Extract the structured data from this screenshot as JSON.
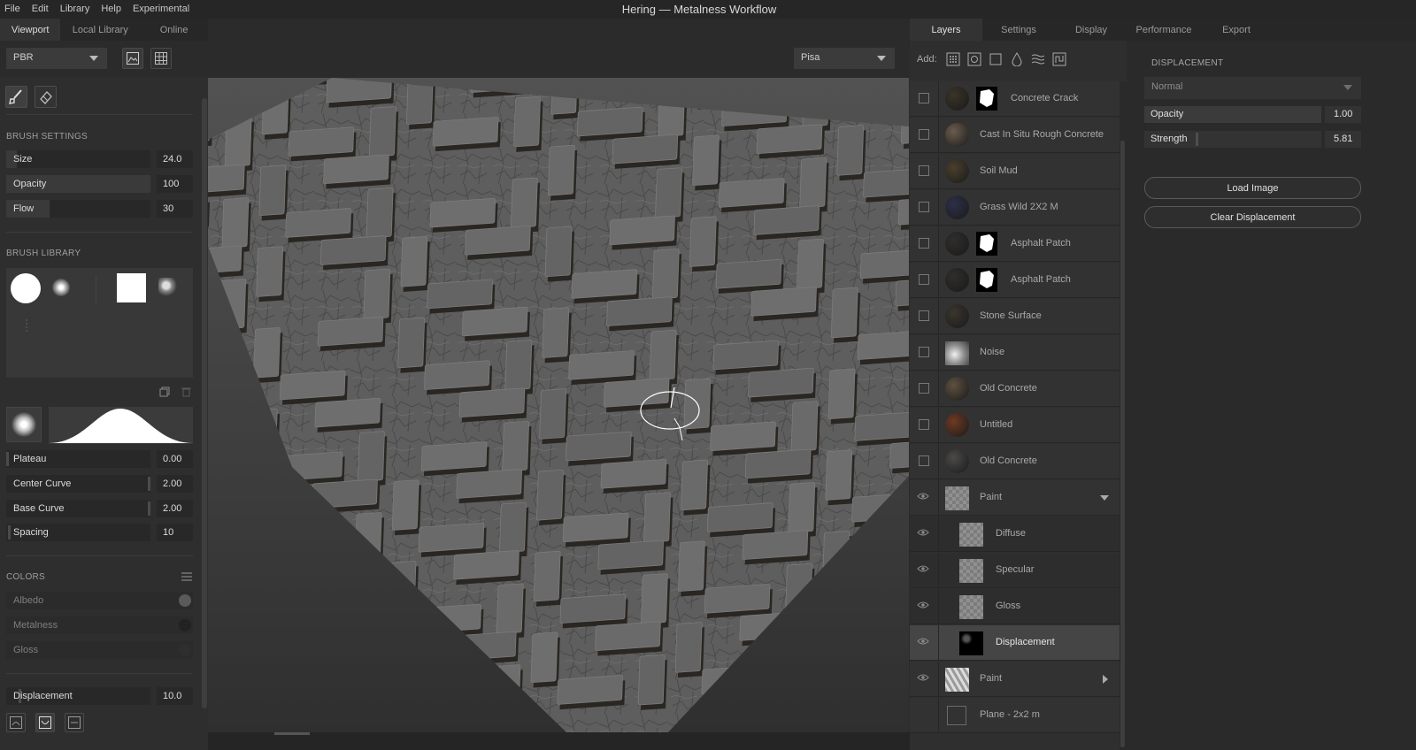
{
  "app": {
    "title": "Hering — Metalness Workflow"
  },
  "menu": [
    "File",
    "Edit",
    "Library",
    "Help",
    "Experimental"
  ],
  "left_tabs": [
    {
      "label": "Viewport",
      "active": true
    },
    {
      "label": "Local Library",
      "active": false
    },
    {
      "label": "Online",
      "active": false
    }
  ],
  "toolbar": {
    "mode": "PBR",
    "icons": [
      "image-icon",
      "grid-icon"
    ],
    "environment": "Pisa"
  },
  "tools": [
    "paint-brush-icon",
    "eraser-icon"
  ],
  "brush_settings": {
    "title": "BRUSH SETTINGS",
    "sliders": [
      {
        "label": "Size",
        "value": "24.0",
        "level": 0.04
      },
      {
        "label": "Opacity",
        "value": "100",
        "level": 1.0
      },
      {
        "label": "Flow",
        "value": "30",
        "level": 0.3
      }
    ]
  },
  "brush_library": {
    "title": "BRUSH LIBRARY",
    "brushes": [
      "hard-round-brush",
      "soft-round-brush",
      "square-brush",
      "scatter-brush"
    ]
  },
  "falloff": {
    "sliders": [
      {
        "label": "Plateau",
        "value": "0.00",
        "level": 0.0
      },
      {
        "label": "Center Curve",
        "value": "2.00",
        "level": 1.0
      },
      {
        "label": "Base Curve",
        "value": "2.00",
        "level": 1.0
      },
      {
        "label": "Spacing",
        "value": "10",
        "level": 0.0
      }
    ]
  },
  "colors": {
    "title": "COLORS",
    "items": [
      {
        "label": "Albedo",
        "color": "#5a5a5a"
      },
      {
        "label": "Metalness",
        "color": "#222222"
      },
      {
        "label": "Gloss",
        "color": "#2e2e2e"
      }
    ]
  },
  "displacement_slider": {
    "label": "Displacement",
    "value": "10.0"
  },
  "bottom_icons": [
    "stack-up-icon",
    "stack-down-icon",
    "stack-flat-icon"
  ],
  "right_tabs": [
    {
      "label": "Layers",
      "active": true
    },
    {
      "label": "Settings",
      "active": false
    },
    {
      "label": "Display",
      "active": false
    },
    {
      "label": "Performance",
      "active": false
    },
    {
      "label": "Export",
      "active": false
    }
  ],
  "add_row": {
    "label": "Add:",
    "icons": [
      "dots-grid-icon",
      "circle-square-icon",
      "square-icon",
      "drop-icon",
      "waves-icon",
      "curve-icon"
    ]
  },
  "layers": [
    {
      "name": "Concrete Crack",
      "kind": "material",
      "thumb": "#3a3428",
      "mask": true
    },
    {
      "name": "Cast In Situ Rough Concrete",
      "kind": "material",
      "thumb": "#6b5c4e",
      "mask": false
    },
    {
      "name": "Soil Mud",
      "kind": "material",
      "thumb": "#4a3f2c",
      "mask": false
    },
    {
      "name": "Grass Wild 2X2 M",
      "kind": "material",
      "thumb": "#2c3048",
      "mask": false
    },
    {
      "name": "Asphalt Patch",
      "kind": "material",
      "thumb": "#2f2e2c",
      "mask": true
    },
    {
      "name": "Asphalt Patch",
      "kind": "material",
      "thumb": "#2f2e2c",
      "mask": true
    },
    {
      "name": "Stone Surface",
      "kind": "material",
      "thumb": "#3a352e",
      "mask": false
    },
    {
      "name": "Noise",
      "kind": "noise",
      "thumb": "#cfcfcf",
      "mask": false
    },
    {
      "name": "Old Concrete",
      "kind": "material",
      "thumb": "#5e5140",
      "mask": false
    },
    {
      "name": "Untitled",
      "kind": "material",
      "thumb": "#6e3a22",
      "mask": false
    },
    {
      "name": "Old Concrete",
      "kind": "material",
      "thumb": "#4b4a48",
      "mask": false
    },
    {
      "name": "Paint",
      "kind": "group-open"
    },
    {
      "name": "Diffuse",
      "kind": "channel"
    },
    {
      "name": "Specular",
      "kind": "channel"
    },
    {
      "name": "Gloss",
      "kind": "channel"
    },
    {
      "name": "Displacement",
      "kind": "channel-selected"
    },
    {
      "name": "Paint",
      "kind": "group-closed"
    },
    {
      "name": "Plane - 2x2 m",
      "kind": "mesh"
    }
  ],
  "properties": {
    "section": "DISPLACEMENT",
    "blend_mode": "Normal",
    "opacity": {
      "label": "Opacity",
      "value": "1.00",
      "level": 1.0
    },
    "strength": {
      "label": "Strength",
      "value": "5.81",
      "level": 0.0
    },
    "load_button": "Load Image",
    "clear_button": "Clear Displacement"
  }
}
